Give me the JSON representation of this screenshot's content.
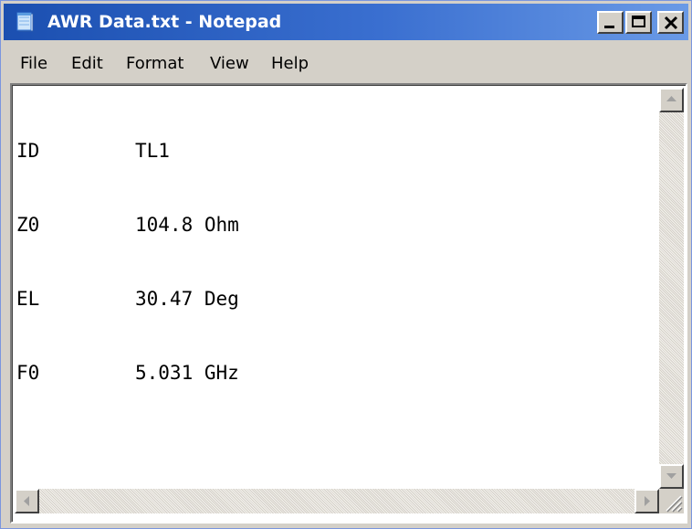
{
  "window": {
    "title": "AWR Data.txt - Notepad",
    "title_icon": "notepad-icon",
    "controls": {
      "minimize_icon": "minimize-icon",
      "maximize_icon": "maximize-icon",
      "close_icon": "close-icon"
    }
  },
  "menu": {
    "items": [
      {
        "label": "File"
      },
      {
        "label": "Edit"
      },
      {
        "label": "Format"
      },
      {
        "label": "View"
      },
      {
        "label": "Help"
      }
    ]
  },
  "document": {
    "lines": [
      {
        "key": "ID",
        "value": "TL1"
      },
      {
        "key": "Z0",
        "value": "104.8 Ohm"
      },
      {
        "key": "EL",
        "value": "30.47 Deg"
      },
      {
        "key": "F0",
        "value": "5.031 GHz"
      }
    ]
  },
  "colors": {
    "titlebar_start": "#1b4fb0",
    "titlebar_end": "#6a9ae6",
    "chrome": "#d4d0c8",
    "editor_background": "#ffffff"
  }
}
